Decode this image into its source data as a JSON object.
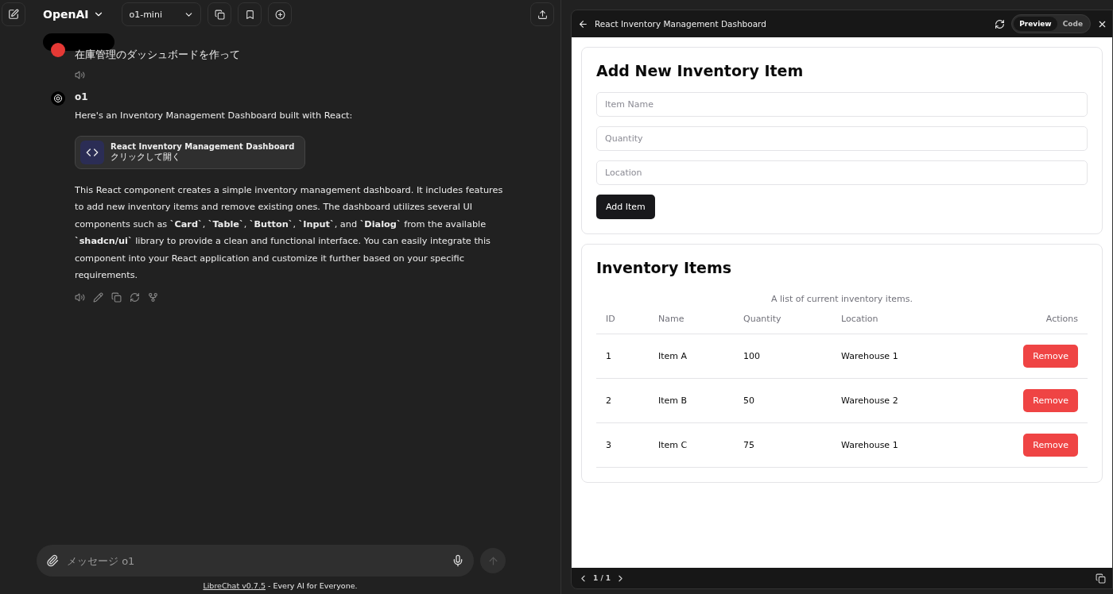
{
  "header": {
    "endpoint": "OpenAI",
    "model": "o1-mini"
  },
  "messages": [
    {
      "kind": "user",
      "text": "在庫管理のダッシュボードを作って"
    },
    {
      "kind": "assistant",
      "author": "o1",
      "intro": "Here's an Inventory Management Dashboard built with React:",
      "artifact": {
        "title": "React Inventory Management Dashboard",
        "subtitle": "クリックして開く"
      },
      "body": "This React component creates a simple inventory management dashboard. It includes features to add new inventory items and remove existing ones. The dashboard utilizes several UI components such as **`Card`**, **`Table`**, **`Button`**, **`Input`**, and **`Dialog`** from the available **`shadcn/ui`** library to provide a clean and functional interface. You can easily integrate this component into your React application and customize it further based on your specific requirements."
    }
  ],
  "composer": {
    "placeholder": "メッセージ o1"
  },
  "footer": {
    "link": "LibreChat v0.7.5",
    "text": " - Every AI for Everyone."
  },
  "panel": {
    "title": "React Inventory Management Dashboard",
    "tabs": [
      {
        "label": "Preview",
        "selected": true
      },
      {
        "label": "Code",
        "selected": false
      }
    ],
    "pager": "1 / 1"
  },
  "form": {
    "title": "Add New Inventory Item",
    "fields": [
      {
        "placeholder": "Item Name"
      },
      {
        "placeholder": "Quantity"
      },
      {
        "placeholder": "Location"
      }
    ],
    "button": "Add Item"
  },
  "table": {
    "title": "Inventory Items",
    "caption": "A list of current inventory items.",
    "columns": [
      "ID",
      "Name",
      "Quantity",
      "Location",
      "Actions"
    ],
    "rows": [
      {
        "id": "1",
        "name": "Item A",
        "quantity": "100",
        "location": "Warehouse 1",
        "action": "Remove"
      },
      {
        "id": "2",
        "name": "Item B",
        "quantity": "50",
        "location": "Warehouse 2",
        "action": "Remove"
      },
      {
        "id": "3",
        "name": "Item C",
        "quantity": "75",
        "location": "Warehouse 1",
        "action": "Remove"
      }
    ]
  }
}
